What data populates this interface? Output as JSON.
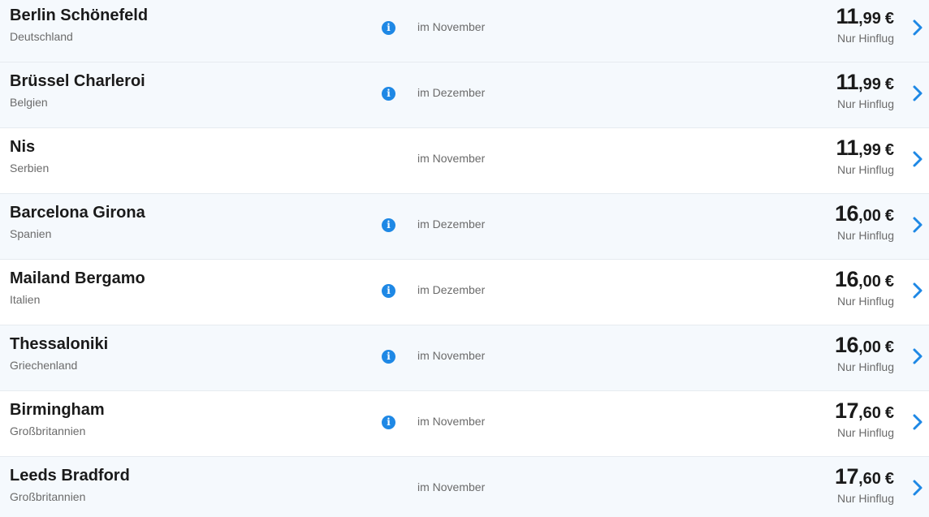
{
  "accent_color": "#1e88e5",
  "icons": {
    "info": "info-icon",
    "arrow": "chevron-right-icon"
  },
  "rows": [
    {
      "city": "Berlin Schönefeld",
      "country": "Deutschland",
      "info": true,
      "month": "im November",
      "price_int": "11",
      "price_dec": ",99",
      "currency": "€",
      "note": "Nur Hinflug"
    },
    {
      "city": "Brüssel Charleroi",
      "country": "Belgien",
      "info": true,
      "month": "im Dezember",
      "price_int": "11",
      "price_dec": ",99",
      "currency": "€",
      "note": "Nur Hinflug"
    },
    {
      "city": "Nis",
      "country": "Serbien",
      "info": false,
      "month": "im November",
      "price_int": "11",
      "price_dec": ",99",
      "currency": "€",
      "note": "Nur Hinflug"
    },
    {
      "city": "Barcelona Girona",
      "country": "Spanien",
      "info": true,
      "month": "im Dezember",
      "price_int": "16",
      "price_dec": ",00",
      "currency": "€",
      "note": "Nur Hinflug"
    },
    {
      "city": "Mailand Bergamo",
      "country": "Italien",
      "info": true,
      "month": "im Dezember",
      "price_int": "16",
      "price_dec": ",00",
      "currency": "€",
      "note": "Nur Hinflug"
    },
    {
      "city": "Thessaloniki",
      "country": "Griechenland",
      "info": true,
      "month": "im November",
      "price_int": "16",
      "price_dec": ",00",
      "currency": "€",
      "note": "Nur Hinflug"
    },
    {
      "city": "Birmingham",
      "country": "Großbritannien",
      "info": true,
      "month": "im November",
      "price_int": "17",
      "price_dec": ",60",
      "currency": "€",
      "note": "Nur Hinflug"
    },
    {
      "city": "Leeds Bradford",
      "country": "Großbritannien",
      "info": false,
      "month": "im November",
      "price_int": "17",
      "price_dec": ",60",
      "currency": "€",
      "note": "Nur Hinflug"
    }
  ]
}
